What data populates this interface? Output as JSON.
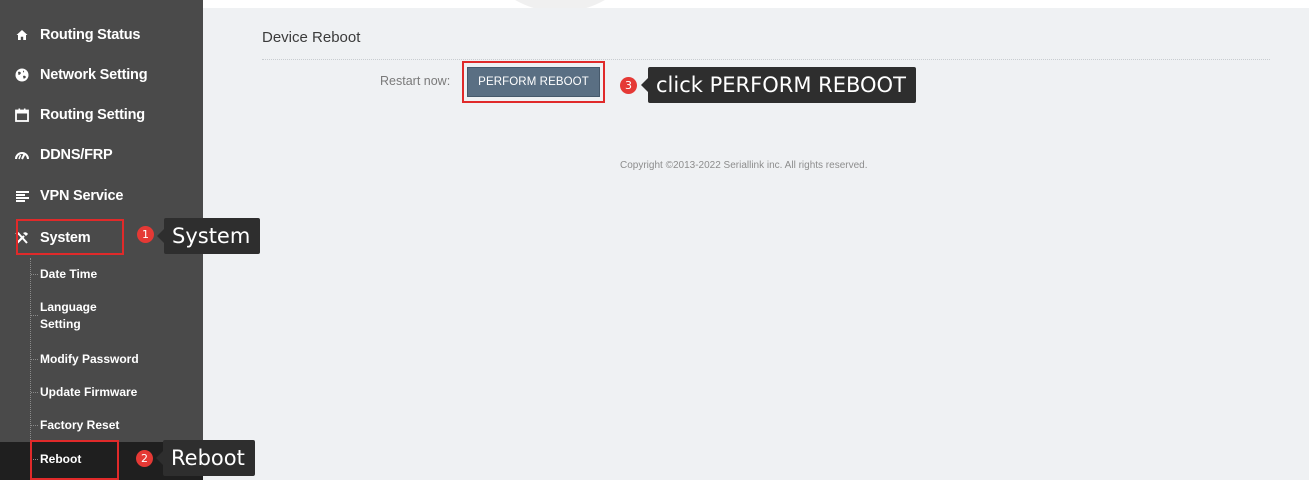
{
  "sidebar": {
    "items": [
      {
        "label": "Routing Status",
        "icon": "home-icon"
      },
      {
        "label": "Network Setting",
        "icon": "globe-icon"
      },
      {
        "label": "Routing Setting",
        "icon": "calendar-icon"
      },
      {
        "label": "DDNS/FRP",
        "icon": "gauge-icon"
      },
      {
        "label": "VPN Service",
        "icon": "list-icon"
      },
      {
        "label": "System",
        "icon": "tools-icon"
      }
    ],
    "subitems": [
      "Date Time",
      "Language Setting",
      "Modify Password",
      "Update Firmware",
      "Factory Reset",
      "Reboot"
    ]
  },
  "main": {
    "title": "Device Reboot",
    "restart_label": "Restart now:",
    "reboot_button": "PERFORM REBOOT",
    "copyright": "Copyright ©2013-2022 Seriallink inc. All rights reserved."
  },
  "annotations": [
    {
      "number": "1",
      "text": "System"
    },
    {
      "number": "2",
      "text": "Reboot"
    },
    {
      "number": "3",
      "text": "click PERFORM REBOOT"
    }
  ],
  "colors": {
    "sidebar": "#4a4a4a",
    "active_row": "#1f1f1f",
    "content_bg": "#eff1f3",
    "button": "#5a6f83",
    "highlight": "#e02a2a",
    "badge": "#e53935"
  }
}
